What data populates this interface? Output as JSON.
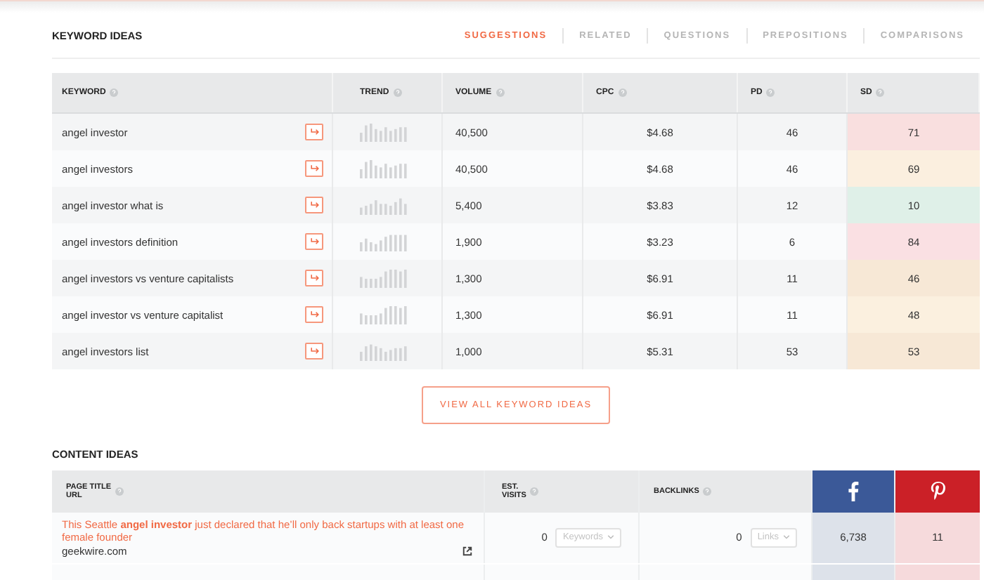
{
  "keyword_ideas": {
    "title": "KEYWORD IDEAS",
    "tabs": [
      {
        "label": "SUGGESTIONS",
        "selected": true
      },
      {
        "label": "RELATED",
        "selected": false
      },
      {
        "label": "QUESTIONS",
        "selected": false
      },
      {
        "label": "PREPOSITIONS",
        "selected": false
      },
      {
        "label": "COMPARISONS",
        "selected": false
      }
    ],
    "table": {
      "columns": [
        "KEYWORD",
        "TREND",
        "VOLUME",
        "CPC",
        "PD",
        "SD"
      ],
      "rows": [
        {
          "keyword": "angel investor",
          "volume": "40,500",
          "cpc": "$4.68",
          "pd": "46",
          "sd": "71",
          "color": "#f9dfdf"
        },
        {
          "keyword": "angel investors",
          "volume": "40,500",
          "cpc": "$4.68",
          "pd": "46",
          "sd": "69",
          "color": "#fbefdf"
        },
        {
          "keyword": "angel investor what is",
          "volume": "5,400",
          "cpc": "$3.83",
          "pd": "12",
          "sd": "10",
          "color": "#dff0e8"
        },
        {
          "keyword": "angel investors definition",
          "volume": "1,900",
          "cpc": "$3.23",
          "pd": "6",
          "sd": "84",
          "color": "#fae0e3"
        },
        {
          "keyword": "angel investors vs venture capitalists",
          "volume": "1,300",
          "cpc": "$6.91",
          "pd": "11",
          "sd": "46",
          "color": "#f7e8d6"
        },
        {
          "keyword": "angel investor vs venture capitalist",
          "volume": "1,300",
          "cpc": "$6.91",
          "pd": "11",
          "sd": "48",
          "color": "#fbf0df"
        },
        {
          "keyword": "angel investors list",
          "volume": "1,000",
          "cpc": "$5.31",
          "pd": "53",
          "sd": "53",
          "color": "#f7e8d6"
        }
      ]
    },
    "view_all_button": "VIEW ALL KEYWORD IDEAS"
  },
  "content_ideas": {
    "title": "CONTENT IDEAS",
    "columns": {
      "title": [
        "PAGE TITLE",
        "URL"
      ],
      "visits": [
        "EST.",
        "VISITS"
      ],
      "backlinks": "BACKLINKS"
    },
    "rows": [
      {
        "title": "This Seattle **angel investor** just declared that he’ll only back startups with at least one female founder",
        "url": "geekwire.com",
        "visits": "0",
        "visits_dropdown": "Keywords",
        "backlinks": "0",
        "backlinks_dropdown": "Links",
        "facebook": "6,738",
        "pinterest": "11"
      }
    ]
  }
}
